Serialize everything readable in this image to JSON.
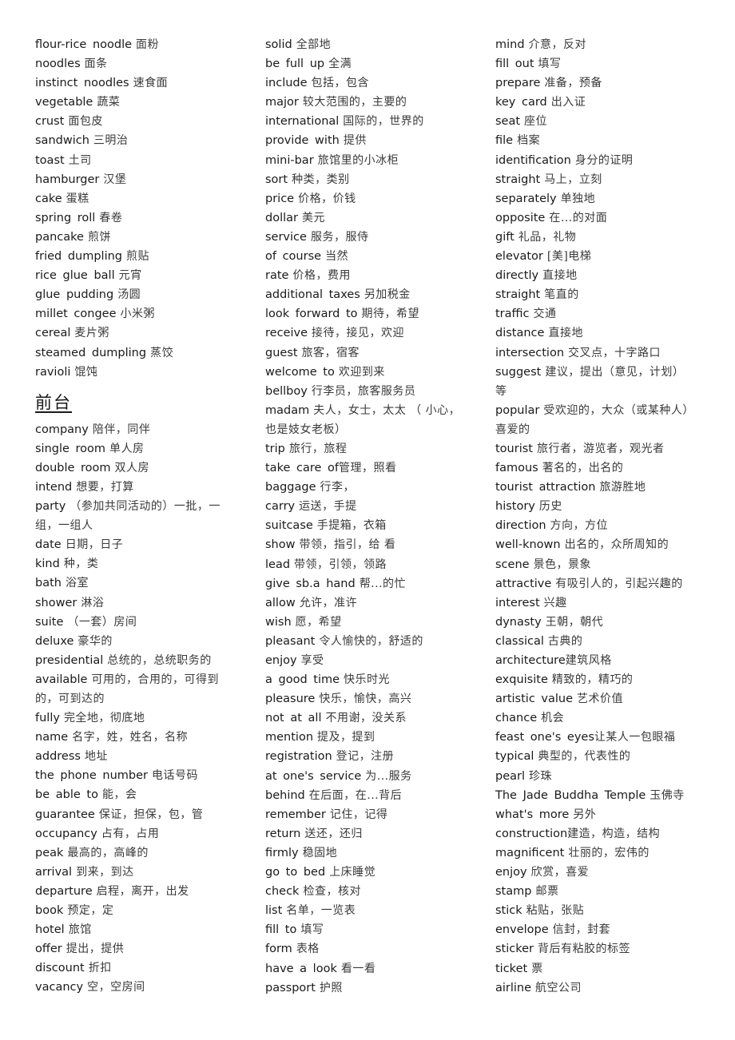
{
  "columns": [
    {
      "items": [
        {
          "type": "entry",
          "en": "flour-rice noodle",
          "zh": "面粉"
        },
        {
          "type": "entry",
          "en": "noodles",
          "zh": "面条"
        },
        {
          "type": "entry",
          "en": "instinct noodles",
          "zh": "速食面"
        },
        {
          "type": "entry",
          "en": "vegetable",
          "zh": "蔬菜"
        },
        {
          "type": "entry",
          "en": "crust",
          "zh": "面包皮"
        },
        {
          "type": "entry",
          "en": "sandwich",
          "zh": "三明治"
        },
        {
          "type": "entry",
          "en": "toast",
          "zh": "土司"
        },
        {
          "type": "entry",
          "en": "hamburger",
          "zh": "汉堡"
        },
        {
          "type": "entry",
          "en": "cake",
          "zh": "蛋糕"
        },
        {
          "type": "entry",
          "en": "spring roll",
          "zh": "春卷"
        },
        {
          "type": "entry",
          "en": "pancake",
          "zh": "煎饼"
        },
        {
          "type": "entry",
          "en": "fried dumpling",
          "zh": "煎贴"
        },
        {
          "type": "entry",
          "en": "rice glue ball",
          "zh": "元宵"
        },
        {
          "type": "entry",
          "en": "glue pudding",
          "zh": "汤圆"
        },
        {
          "type": "entry",
          "en": "millet congee",
          "zh": "小米粥"
        },
        {
          "type": "entry",
          "en": "cereal",
          "zh": "麦片粥"
        },
        {
          "type": "entry",
          "en": "steamed dumpling",
          "zh": "蒸饺"
        },
        {
          "type": "entry",
          "en": "ravioli",
          "zh": "馄饨"
        },
        {
          "type": "heading",
          "text": "前台"
        },
        {
          "type": "entry",
          "en": "company",
          "zh": "陪伴，同伴"
        },
        {
          "type": "entry",
          "en": "single room",
          "zh": "单人房"
        },
        {
          "type": "entry",
          "en": "double room",
          "zh": "双人房"
        },
        {
          "type": "entry",
          "en": "intend",
          "zh": "想要，打算"
        },
        {
          "type": "entry",
          "en": "party",
          "zh": "（参加共同活动的）一批，一"
        },
        {
          "type": "continuation",
          "text": "组，一组人"
        },
        {
          "type": "entry",
          "en": "date",
          "zh": "日期，日子"
        },
        {
          "type": "entry",
          "en": "kind",
          "zh": "种，类"
        },
        {
          "type": "entry",
          "en": "bath",
          "zh": "浴室"
        },
        {
          "type": "entry",
          "en": "shower",
          "zh": "淋浴"
        },
        {
          "type": "entry",
          "en": "suite",
          "zh": "（一套）房间"
        },
        {
          "type": "entry",
          "en": "deluxe",
          "zh": "豪华的"
        },
        {
          "type": "entry",
          "en": "presidential",
          "zh": "总统的，总统职务的"
        },
        {
          "type": "entry",
          "en": "available",
          "zh": "可用的，合用的，可得到"
        },
        {
          "type": "continuation",
          "text": "的，可到达的"
        },
        {
          "type": "entry",
          "en": "fully",
          "zh": "完全地，彻底地"
        },
        {
          "type": "entry",
          "en": "name",
          "zh": "名字，姓，姓名，名称"
        },
        {
          "type": "entry",
          "en": "address",
          "zh": "地址"
        },
        {
          "type": "entry",
          "en": "the phone number",
          "zh": "电话号码"
        },
        {
          "type": "entry",
          "en": "be able to",
          "zh": "能，会"
        },
        {
          "type": "entry",
          "en": "guarantee",
          "zh": "保证，担保，包，管"
        },
        {
          "type": "entry",
          "en": "occupancy",
          "zh": "占有，占用"
        },
        {
          "type": "entry",
          "en": "peak",
          "zh": "最高的，高峰的"
        },
        {
          "type": "entry",
          "en": "arrival",
          "zh": "到来，到达"
        },
        {
          "type": "entry",
          "en": "departure",
          "zh": "启程，离开，出发"
        },
        {
          "type": "entry",
          "en": "book",
          "zh": "预定，定"
        },
        {
          "type": "entry",
          "en": "hotel",
          "zh": "旅馆"
        },
        {
          "type": "entry",
          "en": "offer",
          "zh": "提出，提供"
        },
        {
          "type": "entry",
          "en": "discount",
          "zh": "折扣"
        },
        {
          "type": "entry",
          "en": "vacancy",
          "zh": "空，空房间"
        }
      ]
    },
    {
      "items": [
        {
          "type": "entry",
          "en": "solid",
          "zh": "全部地"
        },
        {
          "type": "entry",
          "en": "be full up",
          "zh": "全满"
        },
        {
          "type": "entry",
          "en": "include",
          "zh": "包括，包含"
        },
        {
          "type": "entry",
          "en": "major",
          "zh": "较大范围的，主要的"
        },
        {
          "type": "entry",
          "en": "international",
          "zh": "国际的，世界的"
        },
        {
          "type": "entry",
          "en": "provide with",
          "zh": "提供"
        },
        {
          "type": "entry",
          "en": "mini-bar",
          "zh": "旅馆里的小冰柜"
        },
        {
          "type": "entry",
          "en": "sort",
          "zh": "种类，类别"
        },
        {
          "type": "entry",
          "en": "price",
          "zh": "价格，价钱"
        },
        {
          "type": "entry",
          "en": "dollar",
          "zh": "美元"
        },
        {
          "type": "entry",
          "en": "service",
          "zh": "服务，服侍"
        },
        {
          "type": "entry",
          "en": "of course",
          "zh": "当然"
        },
        {
          "type": "entry",
          "en": "rate",
          "zh": "价格，费用"
        },
        {
          "type": "entry",
          "en": "additional taxes",
          "zh": "另加税金"
        },
        {
          "type": "entry",
          "en": "look forward to",
          "zh": "期待，希望"
        },
        {
          "type": "entry",
          "en": "receive",
          "zh": "接待，接见，欢迎"
        },
        {
          "type": "entry",
          "en": "guest",
          "zh": "旅客，宿客"
        },
        {
          "type": "entry",
          "en": "welcome to",
          "zh": "欢迎到来"
        },
        {
          "type": "entry",
          "en": "bellboy",
          "zh": "行李员，旅客服务员"
        },
        {
          "type": "entry",
          "en": "madam",
          "zh": "夫人，女士，太太 （ 小心，"
        },
        {
          "type": "continuation",
          "text": "也是妓女老板）"
        },
        {
          "type": "entry",
          "en": "trip",
          "zh": "旅行，旅程"
        },
        {
          "type": "entry",
          "en": "take care of",
          "zh": "管理，照看",
          "tight": true
        },
        {
          "type": "entry",
          "en": "baggage",
          "zh": "行李，"
        },
        {
          "type": "entry",
          "en": "carry",
          "zh": "运送，手提"
        },
        {
          "type": "entry",
          "en": "suitcase",
          "zh": "手提箱，衣箱"
        },
        {
          "type": "entry",
          "en": "show",
          "zh": "带领，指引，给 看"
        },
        {
          "type": "entry",
          "en": "lead",
          "zh": "带领，引领，领路"
        },
        {
          "type": "entry",
          "en": "give sb.a hand",
          "zh": "帮...的忙"
        },
        {
          "type": "entry",
          "en": "allow",
          "zh": "允许，准许"
        },
        {
          "type": "entry",
          "en": "wish",
          "zh": "愿，希望"
        },
        {
          "type": "entry",
          "en": "pleasant",
          "zh": "令人愉快的，舒适的"
        },
        {
          "type": "entry",
          "en": "enjoy",
          "zh": "享受"
        },
        {
          "type": "entry",
          "en": "a good time",
          "zh": "快乐时光"
        },
        {
          "type": "entry",
          "en": "pleasure",
          "zh": "快乐，愉快，高兴"
        },
        {
          "type": "entry",
          "en": "not at all",
          "zh": "不用谢，没关系"
        },
        {
          "type": "entry",
          "en": "mention",
          "zh": "提及，提到"
        },
        {
          "type": "entry",
          "en": "registration",
          "zh": "登记，注册"
        },
        {
          "type": "entry",
          "en": "at one's service",
          "zh": "为...服务"
        },
        {
          "type": "entry",
          "en": "behind",
          "zh": "在后面，在...背后"
        },
        {
          "type": "entry",
          "en": "remember",
          "zh": "记住，记得"
        },
        {
          "type": "entry",
          "en": "return",
          "zh": "送还，还归"
        },
        {
          "type": "entry",
          "en": "firmly",
          "zh": "稳固地"
        },
        {
          "type": "entry",
          "en": "go to bed",
          "zh": "上床睡觉"
        },
        {
          "type": "entry",
          "en": "check",
          "zh": "检查，核对"
        },
        {
          "type": "entry",
          "en": "list",
          "zh": "名单，一览表"
        },
        {
          "type": "entry",
          "en": "fill to",
          "zh": "填写"
        },
        {
          "type": "entry",
          "en": "form",
          "zh": "表格"
        },
        {
          "type": "entry",
          "en": "have a look",
          "zh": "看一看"
        },
        {
          "type": "entry",
          "en": "passport",
          "zh": "护照"
        }
      ]
    },
    {
      "items": [
        {
          "type": "entry",
          "en": "mind",
          "zh": "介意，反对"
        },
        {
          "type": "entry",
          "en": "fill out",
          "zh": "填写"
        },
        {
          "type": "entry",
          "en": "prepare",
          "zh": "准备，预备"
        },
        {
          "type": "entry",
          "en": "key card",
          "zh": "出入证"
        },
        {
          "type": "entry",
          "en": "seat",
          "zh": "座位"
        },
        {
          "type": "entry",
          "en": "file",
          "zh": "档案"
        },
        {
          "type": "entry",
          "en": "identification",
          "zh": "身分的证明"
        },
        {
          "type": "entry",
          "en": "straight",
          "zh": "马上，立刻"
        },
        {
          "type": "entry",
          "en": "separately",
          "zh": "单独地"
        },
        {
          "type": "entry",
          "en": "opposite",
          "zh": "在...的对面"
        },
        {
          "type": "entry",
          "en": "gift",
          "zh": "礼品，礼物"
        },
        {
          "type": "entry",
          "en": "elevator",
          "zh": "[美]电梯"
        },
        {
          "type": "entry",
          "en": "directly",
          "zh": "直接地"
        },
        {
          "type": "entry",
          "en": "straight",
          "zh": "笔直的"
        },
        {
          "type": "entry",
          "en": "traffic",
          "zh": "交通"
        },
        {
          "type": "entry",
          "en": "distance",
          "zh": "直接地"
        },
        {
          "type": "entry",
          "en": "intersection",
          "zh": "交叉点，十字路口"
        },
        {
          "type": "entry",
          "en": "suggest",
          "zh": "建议，提出（意见，计划）"
        },
        {
          "type": "continuation",
          "text": "等"
        },
        {
          "type": "entry",
          "en": "popular",
          "zh": "受欢迎的，大众（或某种人）"
        },
        {
          "type": "continuation",
          "text": "喜爱的"
        },
        {
          "type": "entry",
          "en": "tourist",
          "zh": "旅行者，游览者，观光者"
        },
        {
          "type": "entry",
          "en": "famous",
          "zh": "著名的，出名的"
        },
        {
          "type": "entry",
          "en": "tourist attraction",
          "zh": "旅游胜地"
        },
        {
          "type": "entry",
          "en": "history",
          "zh": "历史"
        },
        {
          "type": "entry",
          "en": "direction",
          "zh": "方向，方位"
        },
        {
          "type": "entry",
          "en": "well-known",
          "zh": "出名的，众所周知的"
        },
        {
          "type": "entry",
          "en": "scene",
          "zh": "景色，景象"
        },
        {
          "type": "entry",
          "en": "attractive",
          "zh": "有吸引人的，引起兴趣的"
        },
        {
          "type": "entry",
          "en": "interest",
          "zh": "兴趣"
        },
        {
          "type": "entry",
          "en": "dynasty",
          "zh": "王朝，朝代"
        },
        {
          "type": "entry",
          "en": "classical",
          "zh": "古典的"
        },
        {
          "type": "entry",
          "en": "architecture",
          "zh": "建筑风格",
          "tight": true
        },
        {
          "type": "entry",
          "en": "exquisite",
          "zh": "精致的，精巧的"
        },
        {
          "type": "entry",
          "en": "artistic value",
          "zh": "艺术价值"
        },
        {
          "type": "entry",
          "en": "chance",
          "zh": "机会"
        },
        {
          "type": "entry",
          "en": "feast one's eyes",
          "zh": "让某人一包眼福",
          "tight": true
        },
        {
          "type": "entry",
          "en": "typical",
          "zh": "典型的，代表性的"
        },
        {
          "type": "entry",
          "en": "pearl",
          "zh": "珍珠"
        },
        {
          "type": "entry",
          "en": "The Jade Buddha Temple",
          "zh": "玉佛寺"
        },
        {
          "type": "entry",
          "en": "what's more",
          "zh": "另外"
        },
        {
          "type": "entry",
          "en": "construction",
          "zh": "建造，构造，结构",
          "tight": true
        },
        {
          "type": "entry",
          "en": "magnificent",
          "zh": "壮丽的，宏伟的"
        },
        {
          "type": "entry",
          "en": "enjoy",
          "zh": "欣赏，喜爱"
        },
        {
          "type": "entry",
          "en": "stamp",
          "zh": "邮票"
        },
        {
          "type": "entry",
          "en": "stick",
          "zh": "粘贴，张贴"
        },
        {
          "type": "entry",
          "en": "envelope",
          "zh": "信封，封套"
        },
        {
          "type": "entry",
          "en": "sticker",
          "zh": "背后有粘胶的标签"
        },
        {
          "type": "entry",
          "en": "ticket",
          "zh": "票"
        },
        {
          "type": "entry",
          "en": "airline",
          "zh": "航空公司"
        }
      ]
    }
  ]
}
